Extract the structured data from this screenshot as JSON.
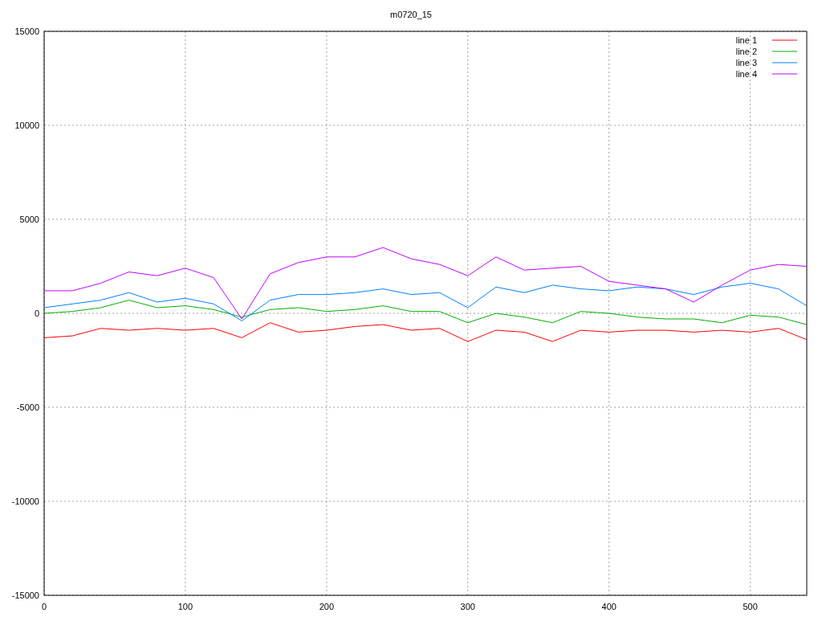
{
  "chart": {
    "chart_data": {
      "type": "line",
      "title": "m0720_15",
      "grid": true,
      "legend": true,
      "x": [
        0,
        20,
        40,
        60,
        80,
        100,
        120,
        140,
        160,
        180,
        200,
        220,
        240,
        260,
        280,
        300,
        320,
        340,
        360,
        380,
        400,
        420,
        440,
        460,
        480,
        500,
        520,
        540
      ],
      "xlim": [
        0,
        540
      ],
      "ylim": [
        -15000,
        15000
      ],
      "xticks": [
        0,
        100,
        200,
        300,
        400,
        500
      ],
      "yticks": [
        -15000,
        -10000,
        -5000,
        0,
        5000,
        10000,
        15000
      ],
      "series": [
        {
          "name": "line 1",
          "color": "#ff0000",
          "values": [
            -1300,
            -1200,
            -800,
            -900,
            -800,
            -900,
            -800,
            -1300,
            -500,
            -1000,
            -900,
            -700,
            -600,
            -900,
            -800,
            -1500,
            -900,
            -1000,
            -1500,
            -900,
            -1000,
            -900,
            -900,
            -1000,
            -900,
            -1000,
            -800,
            -1400
          ]
        },
        {
          "name": "line 2",
          "color": "#00b000",
          "values": [
            0,
            100,
            300,
            700,
            300,
            400,
            200,
            -200,
            200,
            300,
            100,
            200,
            400,
            100,
            100,
            -500,
            0,
            -200,
            -500,
            100,
            0,
            -200,
            -300,
            -300,
            -500,
            -100,
            -200,
            -600
          ]
        },
        {
          "name": "line 3",
          "color": "#0080ff",
          "values": [
            300,
            500,
            700,
            1100,
            600,
            800,
            500,
            -400,
            700,
            1000,
            1000,
            1100,
            1300,
            1000,
            1100,
            300,
            1400,
            1100,
            1500,
            1300,
            1200,
            1400,
            1300,
            1000,
            1400,
            1600,
            1300,
            400
          ]
        },
        {
          "name": "line 4",
          "color": "#c000ff",
          "values": [
            1200,
            1200,
            1600,
            2200,
            2000,
            2400,
            1900,
            -300,
            2100,
            2700,
            3000,
            3000,
            3500,
            2900,
            2600,
            2000,
            3000,
            2300,
            2400,
            2500,
            1700,
            1500,
            1300,
            600,
            1500,
            2300,
            2600,
            2500
          ]
        }
      ]
    }
  }
}
